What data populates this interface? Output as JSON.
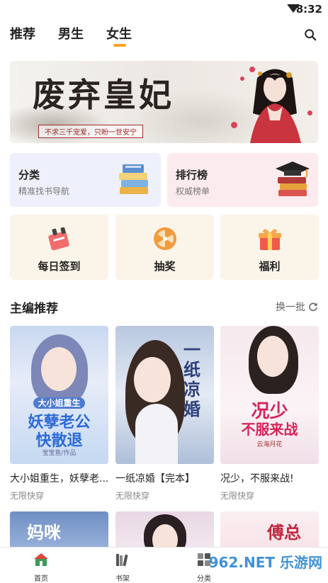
{
  "status": {
    "time": "8:32"
  },
  "tabs": [
    {
      "label": "推荐"
    },
    {
      "label": "男生"
    },
    {
      "label": "女生"
    }
  ],
  "banner": {
    "title": "废弃皇妃",
    "subtitle": "不求三千宠爱，只盼一世安宁"
  },
  "quick": {
    "category": {
      "title": "分类",
      "subtitle": "精准找书导航"
    },
    "ranking": {
      "title": "排行榜",
      "subtitle": "权威榜单"
    }
  },
  "features": [
    {
      "label": "每日签到",
      "icon": "sign-in-icon"
    },
    {
      "label": "抽奖",
      "icon": "lottery-wheel-icon"
    },
    {
      "label": "福利",
      "icon": "gift-icon"
    }
  ],
  "section": {
    "title": "主编推荐",
    "refresh_label": "换一批"
  },
  "books": [
    {
      "title": "大小姐重生，妖孽老...",
      "category": "无限快穿",
      "cover_line1": "大小姐重生",
      "cover_line2": "妖孽老公",
      "cover_line3": "快散退",
      "cover_author": "宝宝鱼/作品"
    },
    {
      "title": "一纸凉婚【完本】",
      "category": "无限快穿",
      "cover_text": "一纸凉婚"
    },
    {
      "title": "况少，不服来战!",
      "category": "无限快穿",
      "cover_line1": "况少",
      "cover_line2": "不服来战",
      "cover_author": "云海月花"
    }
  ],
  "books_row2": [
    {
      "cover_text": "妈咪"
    },
    {
      "cover_text": ""
    },
    {
      "cover_text": "傅总"
    }
  ],
  "bottom_nav": [
    {
      "label": "首页"
    },
    {
      "label": "书架"
    },
    {
      "label": "分类"
    }
  ],
  "watermark": "962.NET 乐游网",
  "colors": {
    "accent": "#f6a623",
    "primary_text": "#222222",
    "muted_text": "#888888"
  }
}
